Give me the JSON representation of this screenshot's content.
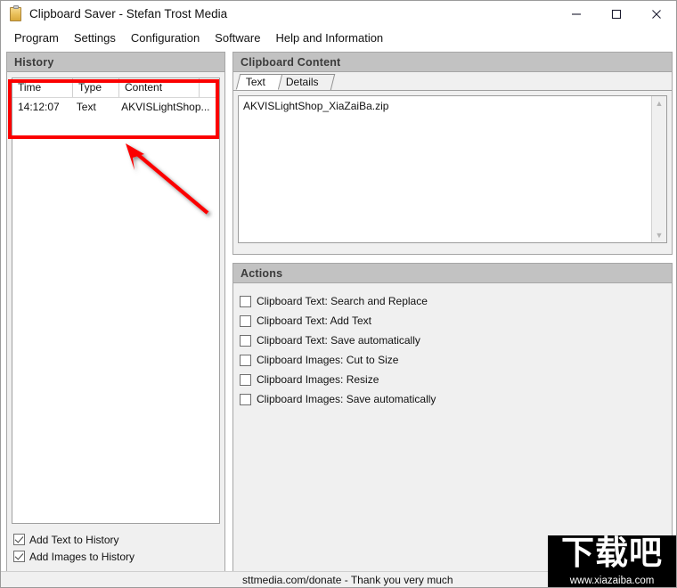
{
  "window": {
    "title": "Clipboard Saver - Stefan Trost Media",
    "icon": "clipboard-icon",
    "controls": {
      "minimize": "minimize-icon",
      "maximize": "maximize-icon",
      "close": "close-icon"
    }
  },
  "menubar": {
    "items": [
      {
        "label": "Program"
      },
      {
        "label": "Settings"
      },
      {
        "label": "Configuration"
      },
      {
        "label": "Software"
      },
      {
        "label": "Help and Information"
      }
    ]
  },
  "history": {
    "title": "History",
    "columns": [
      "Time",
      "Type",
      "Content"
    ],
    "rows": [
      {
        "time": "14:12:07",
        "type": "Text",
        "content": "AKVISLightShop..."
      }
    ],
    "options": [
      {
        "label": "Add Text to History",
        "checked": true
      },
      {
        "label": "Add Images to History",
        "checked": true
      }
    ]
  },
  "clipboard_content": {
    "title": "Clipboard Content",
    "tabs": [
      {
        "label": "Text",
        "active": true
      },
      {
        "label": "Details",
        "active": false
      }
    ],
    "text": "AKVISLightShop_XiaZaiBa.zip",
    "scrollbar": {
      "up": "scroll-up-arrow",
      "down": "scroll-down-arrow"
    }
  },
  "actions": {
    "title": "Actions",
    "items": [
      {
        "label": "Clipboard Text: Search and Replace",
        "checked": false
      },
      {
        "label": "Clipboard Text: Add Text",
        "checked": false
      },
      {
        "label": "Clipboard Text: Save automatically",
        "checked": false
      },
      {
        "label": "Clipboard Images: Cut to Size",
        "checked": false
      },
      {
        "label": "Clipboard Images: Resize",
        "checked": false
      },
      {
        "label": "Clipboard Images: Save automatically",
        "checked": false
      }
    ]
  },
  "statusbar": {
    "text": "sttmedia.com/donate - Thank you very much"
  },
  "watermark": {
    "chinese": "下载吧",
    "url": "www.xiazaiba.com"
  },
  "annotations": {
    "highlight_color": "#fb0000",
    "arrow_color": "#fb0000"
  }
}
